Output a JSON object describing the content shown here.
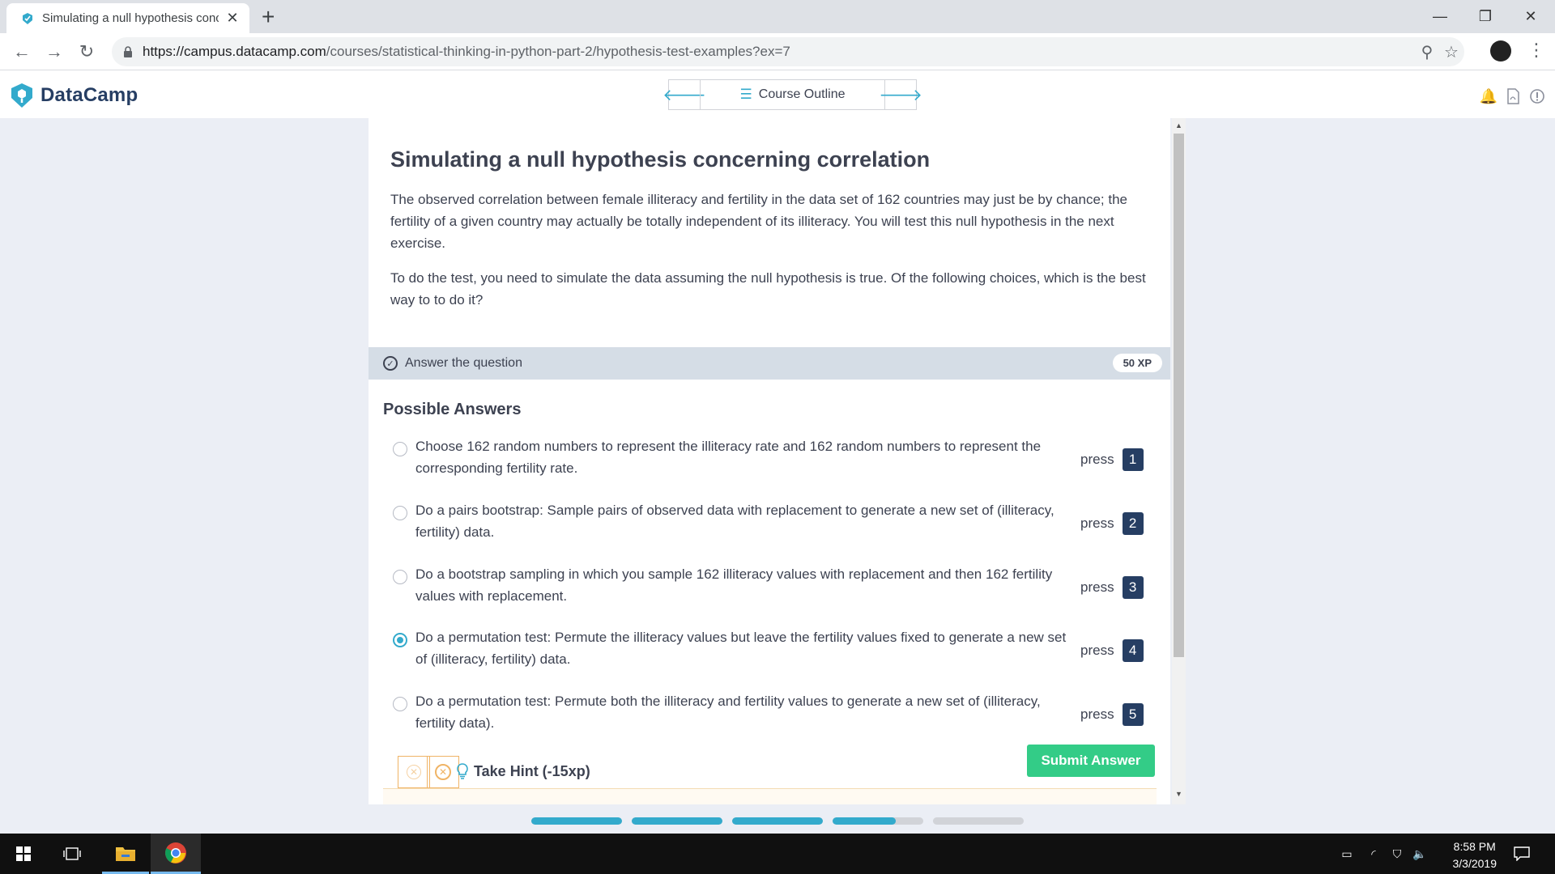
{
  "browser": {
    "tab_title": "Simulating a null hypothesis conc",
    "url_scheme_host": "https://campus.datacamp.com",
    "url_path": "/courses/statistical-thinking-in-python-part-2/hypothesis-test-examples?ex=7"
  },
  "header": {
    "brand": "DataCamp",
    "course_outline_label": "Course Outline"
  },
  "exercise": {
    "title": "Simulating a null hypothesis concerning correlation",
    "paragraph_1": "The observed correlation between female illiteracy and fertility in the data set of 162 countries may just be by chance; the fertility of a given country may actually be totally independent of its illiteracy. You will test this null hypothesis in the next exercise.",
    "paragraph_2": "To do the test, you need to simulate the data assuming the null hypothesis is true. Of the following choices, which is the best way to to do it?",
    "answer_bar_label": "Answer the question",
    "xp": "50 XP",
    "possible_answers_heading": "Possible Answers",
    "options": [
      {
        "text": "Choose 162 random numbers to represent the illiteracy rate and 162 random numbers to represent the corresponding fertility rate.",
        "press": "press",
        "key": "1",
        "selected": false
      },
      {
        "text": "Do a pairs bootstrap: Sample pairs of observed data with replacement to generate a new set of (illiteracy, fertility) data.",
        "press": "press",
        "key": "2",
        "selected": false
      },
      {
        "text": "Do a bootstrap sampling in which you sample 162 illiteracy values with replacement and then 162 fertility values with replacement.",
        "press": "press",
        "key": "3",
        "selected": false
      },
      {
        "text": "Do a permutation test: Permute the illiteracy values but leave the fertility values fixed to generate a new set of (illiteracy, fertility) data.",
        "press": "press",
        "key": "4",
        "selected": true
      },
      {
        "text": "Do a permutation test: Permute both the illiteracy and fertility values to generate a new set of (illiteracy, fertility data).",
        "press": "press",
        "key": "5",
        "selected": false
      }
    ],
    "hint_label": "Take Hint (-15xp)",
    "submit_label": "Submit Answer"
  },
  "progress_segments": [
    1.0,
    1.0,
    1.0,
    0.7,
    0.0
  ],
  "taskbar": {
    "time": "8:58 PM",
    "date": "3/3/2019"
  },
  "colors": {
    "accent": "#33aacc",
    "brand_navy": "#263e63",
    "submit_green": "#33cc87",
    "hint_orange": "#f0b466"
  }
}
